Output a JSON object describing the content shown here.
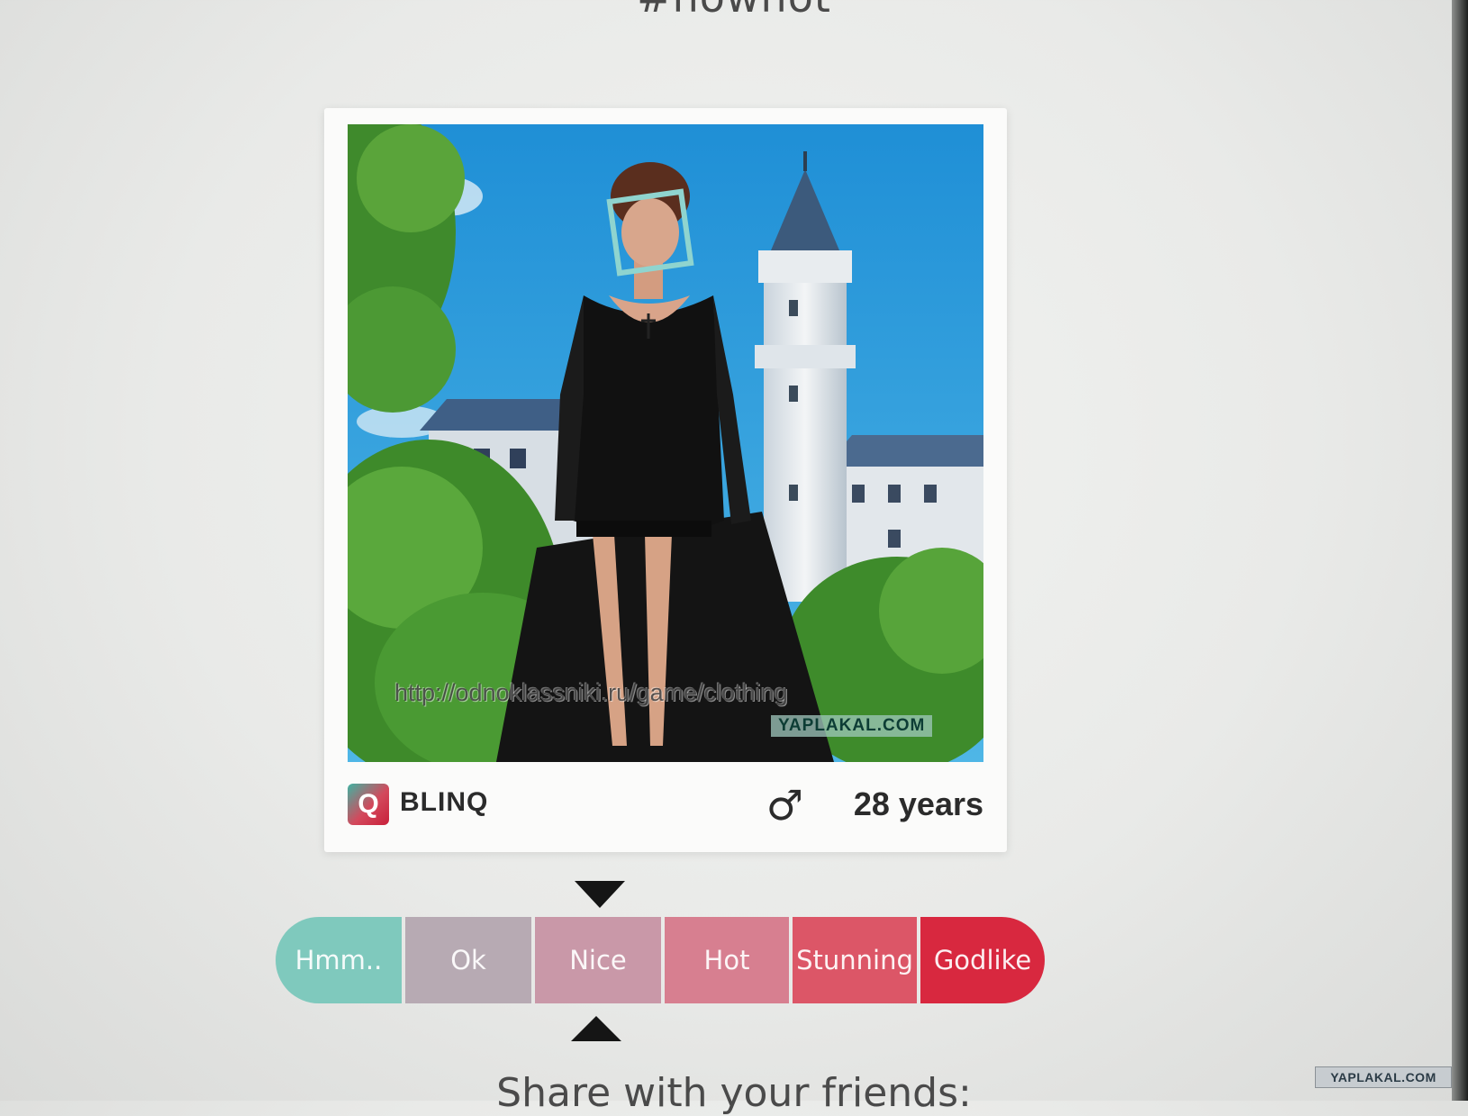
{
  "header": {
    "hashtag": "#howhot"
  },
  "card": {
    "photo": {
      "watermark_url": "http://odnoklassniki.ru/game/clothing",
      "watermark_brand": "YAPLAKAL.COM"
    },
    "footer": {
      "logo_letter": "Q",
      "brand_name": "BLINQ",
      "gender_symbol": "♂",
      "age": "28 years"
    }
  },
  "rating": {
    "selected_index": 2,
    "options": [
      {
        "label": "Hmm..",
        "color": "#7fc9bd"
      },
      {
        "label": "Ok",
        "color": "#b7aab3"
      },
      {
        "label": "Nice",
        "color": "#c998a8"
      },
      {
        "label": "Hot",
        "color": "#d77f90"
      },
      {
        "label": "Stunning",
        "color": "#dc5667"
      },
      {
        "label": "Godlike",
        "color": "#d8283f"
      }
    ]
  },
  "share": {
    "label": "Share with your friends:"
  },
  "corner_stamp": {
    "label": "YAPLAKAL.COM"
  }
}
